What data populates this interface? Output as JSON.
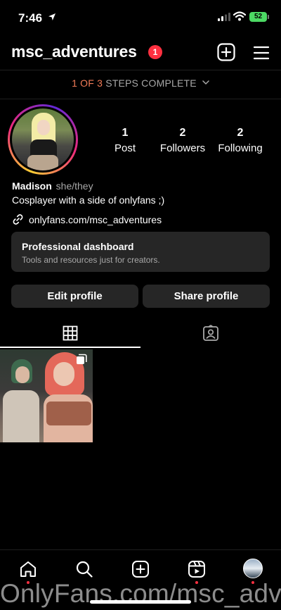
{
  "status_bar": {
    "time": "7:46",
    "battery": "52"
  },
  "header": {
    "username": "msc_adventures",
    "notification_count": "1"
  },
  "steps": {
    "done": "1 OF 3",
    "label": "STEPS COMPLETE"
  },
  "stats": [
    {
      "value": "1",
      "label": "Post"
    },
    {
      "value": "2",
      "label": "Followers"
    },
    {
      "value": "2",
      "label": "Following"
    }
  ],
  "bio": {
    "name": "Madison",
    "pronouns": "she/they",
    "text": "Cosplayer with a side of onlyfans ;)",
    "link": "onlyfans.com/msc_adventures"
  },
  "dashboard": {
    "title": "Professional dashboard",
    "subtitle": "Tools and resources just for creators."
  },
  "buttons": {
    "edit": "Edit profile",
    "share": "Share profile"
  },
  "watermark": "OnlyFans.com/msc_adventures",
  "colors": {
    "accent_orange": "#f27b57",
    "badge_red": "#ff3040",
    "card_bg": "#262626"
  }
}
